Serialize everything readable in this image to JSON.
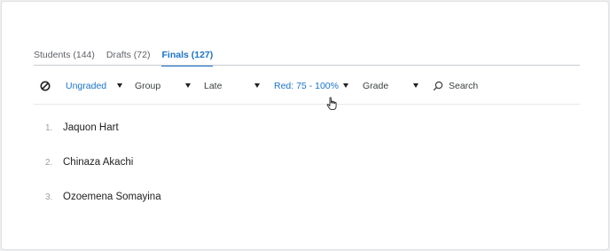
{
  "tabs": [
    {
      "label": "Students (144)"
    },
    {
      "label": "Drafts (72)"
    },
    {
      "label": "Finals (127)"
    }
  ],
  "active_tab": "Finals (127)",
  "filters": {
    "status": "Ungraded",
    "group": "Group",
    "late": "Late",
    "red": "Red: 75 - 100%",
    "grade": "Grade"
  },
  "search": {
    "label": "Search"
  },
  "icons": {
    "clear": "ban-icon",
    "search": "search-icon",
    "pointer": "hand-pointer-icon"
  },
  "students": [
    {
      "num": "1.",
      "name": "Jaquon Hart"
    },
    {
      "num": "2.",
      "name": "Chinaza Akachi"
    },
    {
      "num": "3.",
      "name": "Ozoemena Somayina"
    }
  ],
  "colors": {
    "accent": "#1a73c8",
    "text": "#202124",
    "muted": "#5f6368"
  }
}
